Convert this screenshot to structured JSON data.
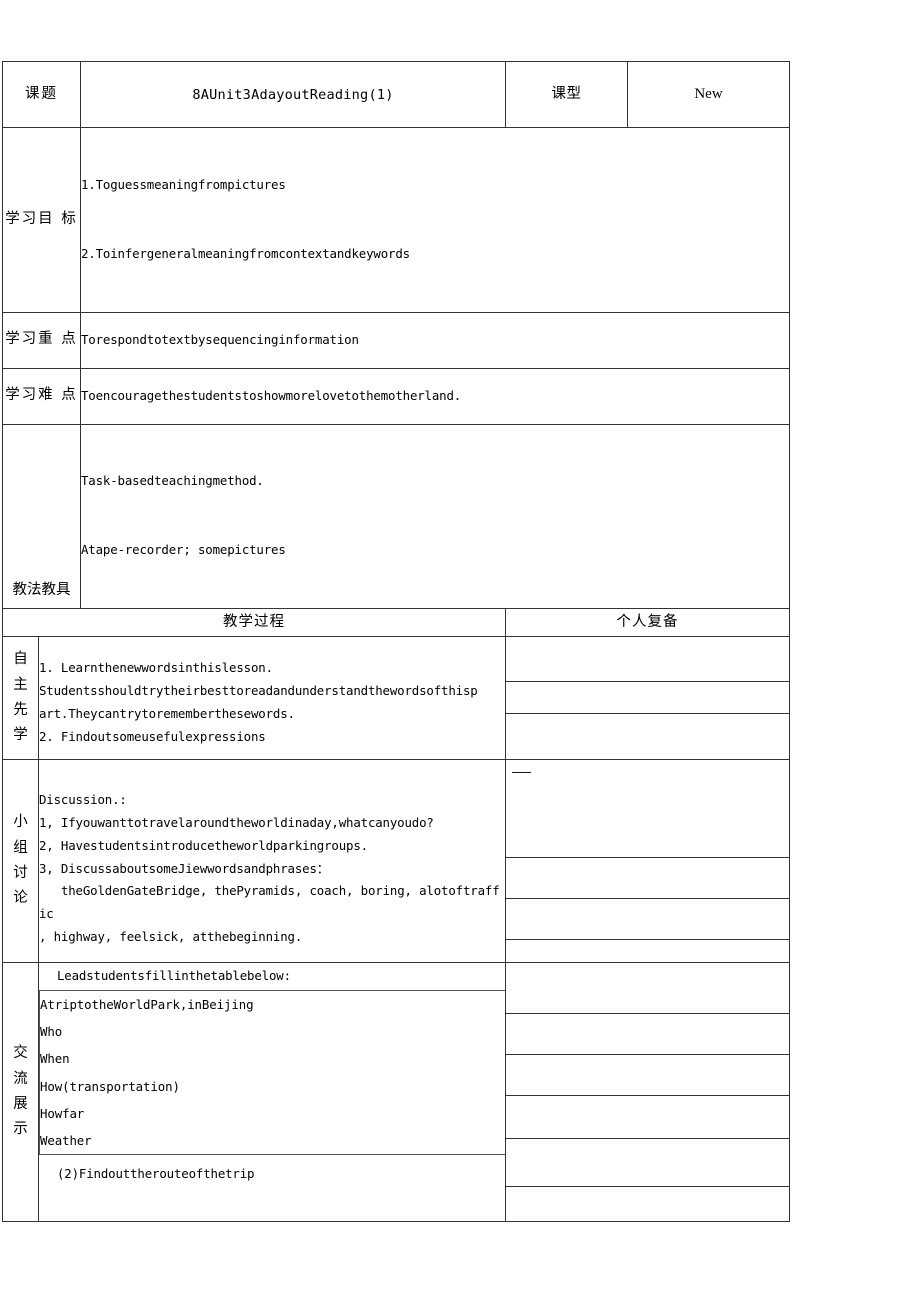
{
  "document": {
    "type": "lesson-plan-table"
  },
  "header": {
    "topic_label": "课题",
    "topic_value": "8AUnit3AdayoutReading(1)",
    "lesson_type_label": "课型",
    "lesson_type_value": "New"
  },
  "rows": {
    "objectives": {
      "label": "学习目标",
      "label_lines": [
        "学习目",
        "标"
      ],
      "lines": [
        "1.Toguessmeaningfrompictures",
        "2.Toinfergeneralmeaningfromcontextandkeywords"
      ]
    },
    "key_points": {
      "label": "学习重点",
      "label_lines": [
        "学习重",
        "点"
      ],
      "text": "Torespondtotextbysequencinginformation"
    },
    "difficult_points": {
      "label": "学习难点",
      "label_lines": [
        "学习难",
        "点"
      ],
      "text": "Toencouragethestudentstoshowmorelovetothemotherland."
    },
    "methods_tools": {
      "label": "教法教具",
      "lines": [
        "Task-basedteachingmethod.",
        "Atape-recorder; somepictures"
      ]
    }
  },
  "process_header": {
    "left": "教学过程",
    "right": "个人复备"
  },
  "sections": [
    {
      "label": "自主先学",
      "label_chars": [
        "自",
        "主",
        "先",
        "学"
      ],
      "body": "1. Learnthenewwordsinthislesson.\nStudentsshouldtrytheirbesttoreadandunderstandthewordsofthisp\nart.Theycantrytorememberthesewords.\n2. Findoutsomeusefulexpressions"
    },
    {
      "label": "小组讨论",
      "label_chars": [
        "小",
        "组",
        "讨",
        "论"
      ],
      "body": "Discussion.:\n1, Ifyouwanttotravelaroundtheworldinaday,whatcanyoudo?\n2, Havestudentsintroducetheworldparkingroups.\n3, DiscussaboutsomeJiewwordsandphrases：\n   theGoldenGateBridge, thePyramids, coach, boring, alotoftraffic\n, highway, feelsick, atthebeginning."
    },
    {
      "label": "交流展示",
      "label_chars": [
        "交",
        "流",
        "展",
        "示"
      ],
      "lead_in": "Leadstudentsfillinthetablebelow:",
      "nested_table": {
        "heading": "AtriptotheWorldPark,inBeijing",
        "rows": [
          "Who",
          "When",
          "How(transportation)",
          "Howfar",
          "Weather"
        ]
      },
      "tail": "(2)Findouttherouteofthetrip"
    }
  ],
  "notes_column": {
    "marks": [
      "—"
    ]
  },
  "colors": {
    "border": "#333333",
    "nested_border": "#555555",
    "text": "#000000",
    "background": "#ffffff"
  }
}
